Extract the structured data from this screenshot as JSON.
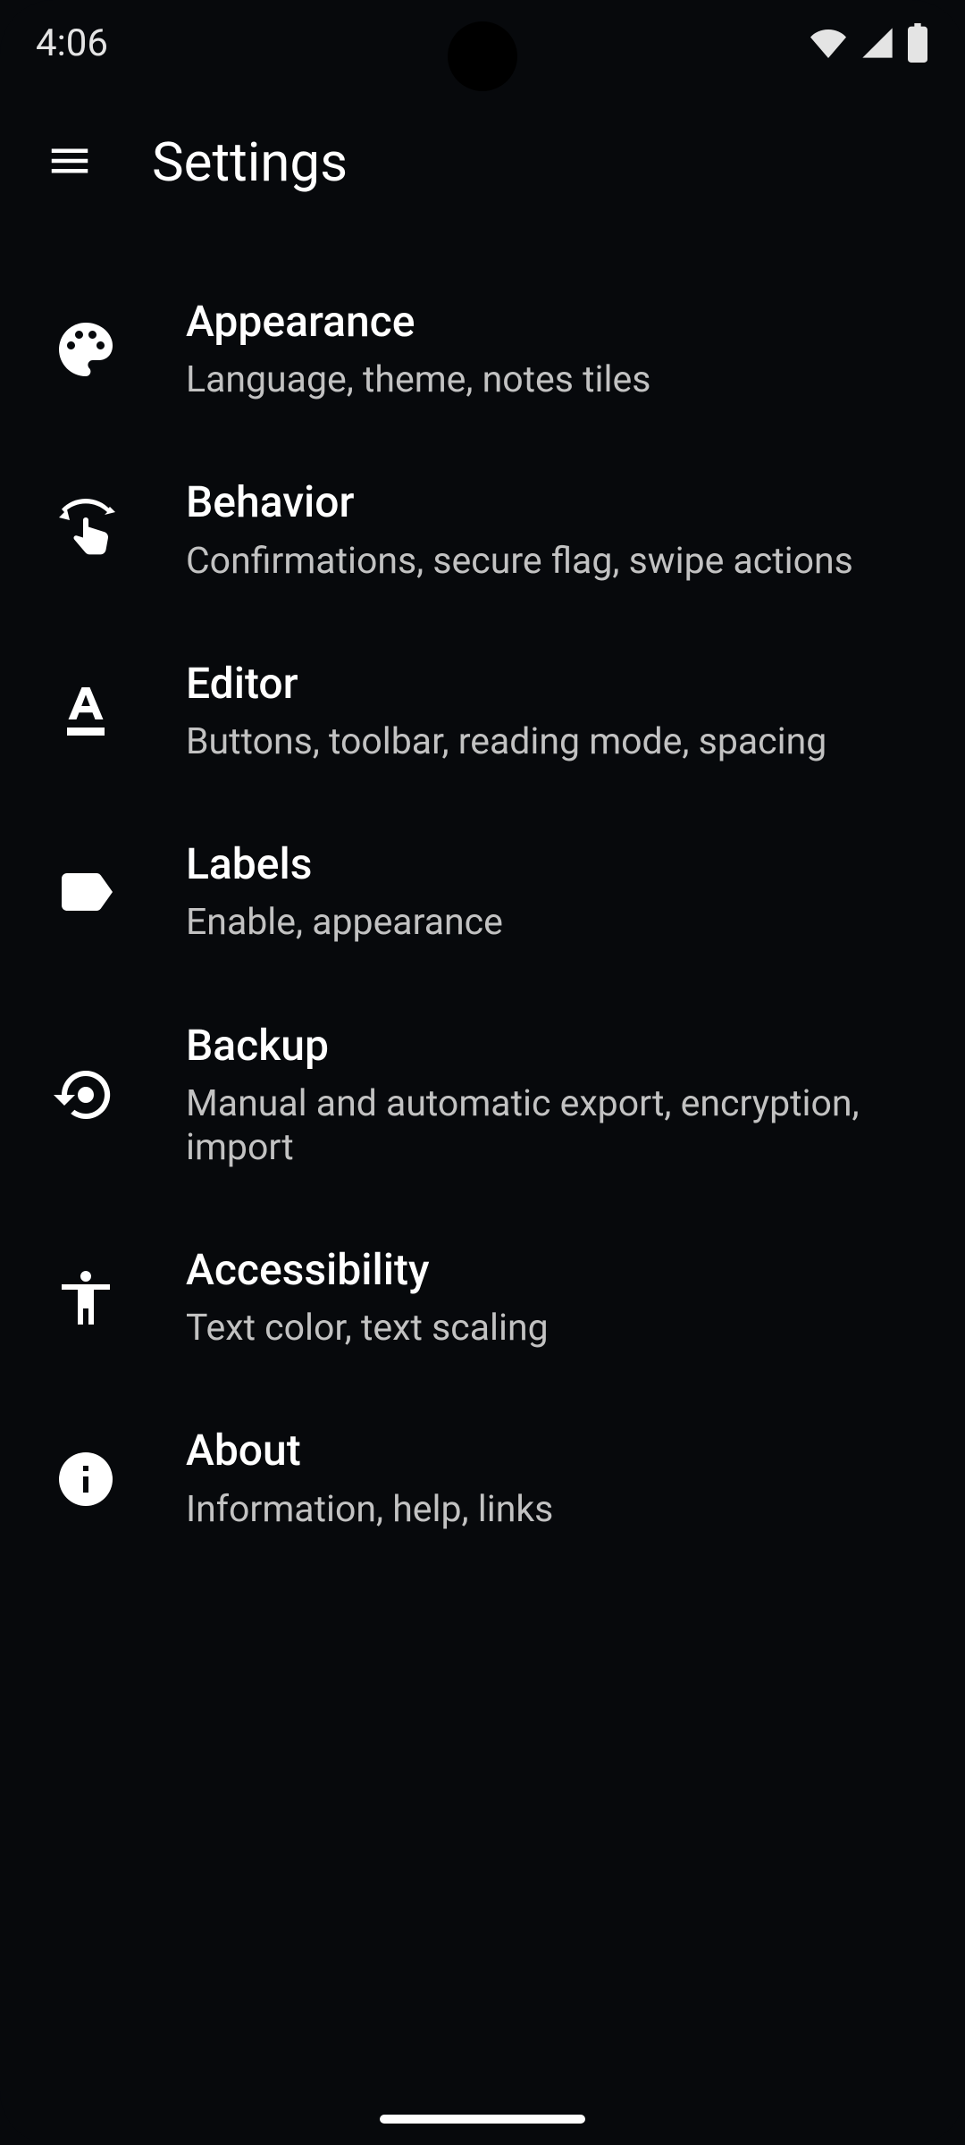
{
  "status": {
    "time": "4:06"
  },
  "header": {
    "title": "Settings"
  },
  "settings": [
    {
      "icon": "palette",
      "title": "Appearance",
      "sub": "Language, theme, notes tiles"
    },
    {
      "icon": "touch-rotate",
      "title": "Behavior",
      "sub": "Confirmations, secure flag, swipe actions"
    },
    {
      "icon": "text-format",
      "title": "Editor",
      "sub": "Buttons, toolbar, reading mode, spacing"
    },
    {
      "icon": "label",
      "title": "Labels",
      "sub": "Enable, appearance"
    },
    {
      "icon": "backup-restore",
      "title": "Backup",
      "sub": "Manual and automatic export, encryption, import"
    },
    {
      "icon": "accessibility",
      "title": "Accessibility",
      "sub": "Text color, text scaling"
    },
    {
      "icon": "info",
      "title": "About",
      "sub": "Information, help, links"
    }
  ]
}
